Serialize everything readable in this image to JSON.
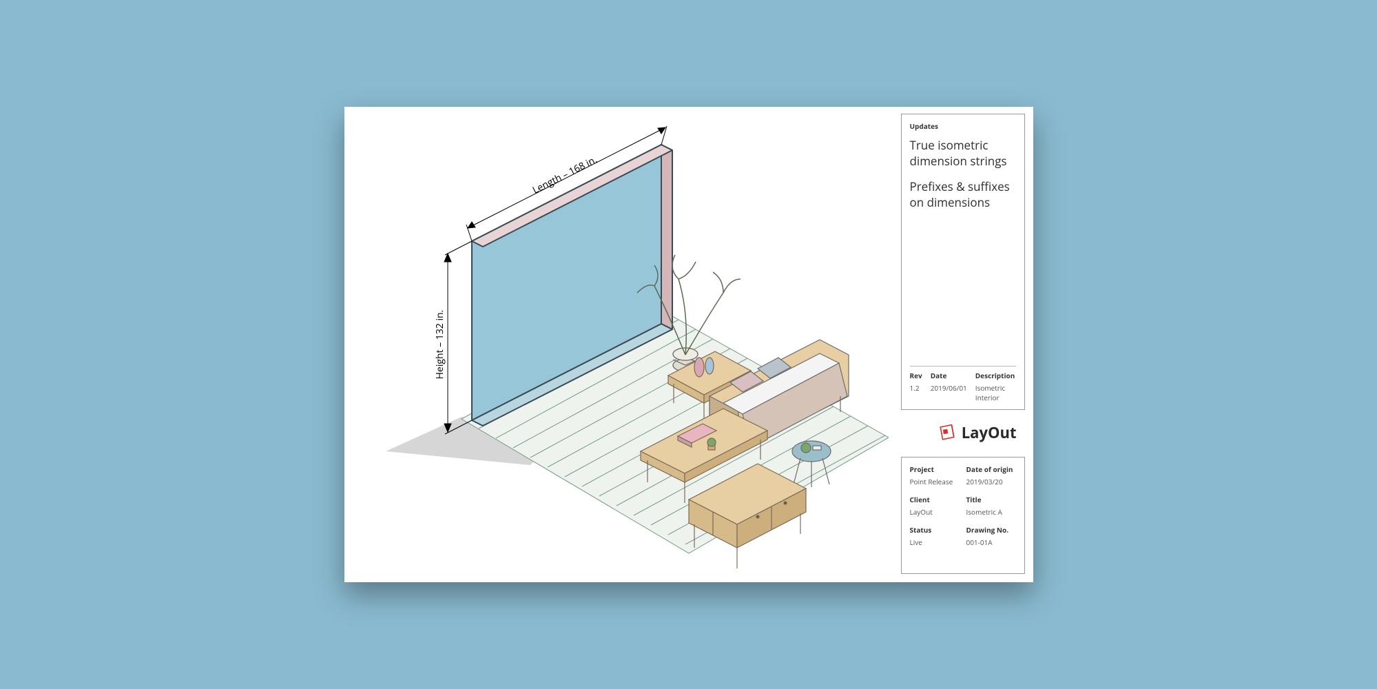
{
  "updates": {
    "header": "Updates",
    "features": [
      "True isometric dimension strings",
      "Prefixes & suffixes on dimensions"
    ],
    "rev": {
      "label": "Rev",
      "value": "1.2"
    },
    "date": {
      "label": "Date",
      "value": "2019/06/01"
    },
    "description": {
      "label": "Description",
      "value": "Isometric Interior"
    }
  },
  "logo": {
    "text": "LayOut"
  },
  "info": {
    "project": {
      "label": "Project",
      "value": "Point Release"
    },
    "date_origin": {
      "label": "Date of origin",
      "value": "2019/03/20"
    },
    "client": {
      "label": "Client",
      "value": "LayOut"
    },
    "title": {
      "label": "Title",
      "value": "Isometric A"
    },
    "status": {
      "label": "Status",
      "value": "Live"
    },
    "drawing_no": {
      "label": "Drawing No.",
      "value": "001-01A"
    }
  },
  "dimensions": {
    "length": "Length – 168 in.",
    "height": "Height – 132 in."
  }
}
